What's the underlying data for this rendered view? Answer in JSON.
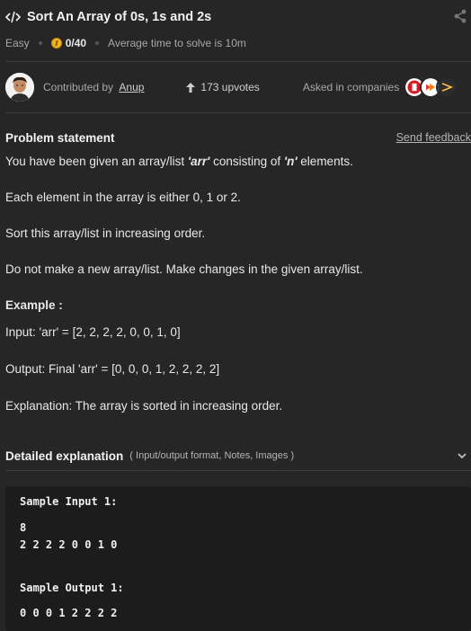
{
  "header": {
    "title": "Sort An Array of 0s, 1s and 2s",
    "difficulty": "Easy",
    "score": "0/40",
    "avg_time": "Average time to solve is 10m",
    "contributed_by_label": "Contributed by",
    "contributor": "Anup",
    "upvotes": "173 upvotes",
    "asked_in": "Asked in companies"
  },
  "problem": {
    "heading": "Problem statement",
    "feedback_link": "Send feedback",
    "p1_a": "You have been given an array/list ",
    "p1_arr": "'arr'",
    "p1_b": " consisting of ",
    "p1_n": "'n'",
    "p1_c": " elements.",
    "p2": "Each element in the array is either 0, 1 or 2.",
    "p3": "Sort this array/list in increasing order.",
    "p4": "Do not make a new array/list. Make changes in the given array/list.",
    "example_heading": "Example :",
    "example_input": "Input: 'arr' = [2, 2, 2, 2, 0, 0, 1, 0]",
    "example_output": "Output: Final 'arr' = [0, 0, 0, 1, 2, 2, 2, 2]",
    "example_explanation": "Explanation: The array is sorted in increasing order."
  },
  "details": {
    "title": "Detailed explanation",
    "subtitle": "( Input/output format, Notes, Images )"
  },
  "sample": {
    "input_label": "Sample Input 1:",
    "input_line1": "8",
    "input_line2": "2 2 2 2 0 0 1 0",
    "output_label": "Sample Output 1:",
    "output_line1": "0 0 0 1 2 2 2 2"
  },
  "icons": {
    "title": "code-icon",
    "share": "share-icon",
    "coin": "coin-icon",
    "upvote": "arrow-up-icon",
    "expand": "chevron-down-icon"
  },
  "colors": {
    "background": "#262626",
    "code_background": "#1c1c1c",
    "coin": "#f0b429"
  }
}
